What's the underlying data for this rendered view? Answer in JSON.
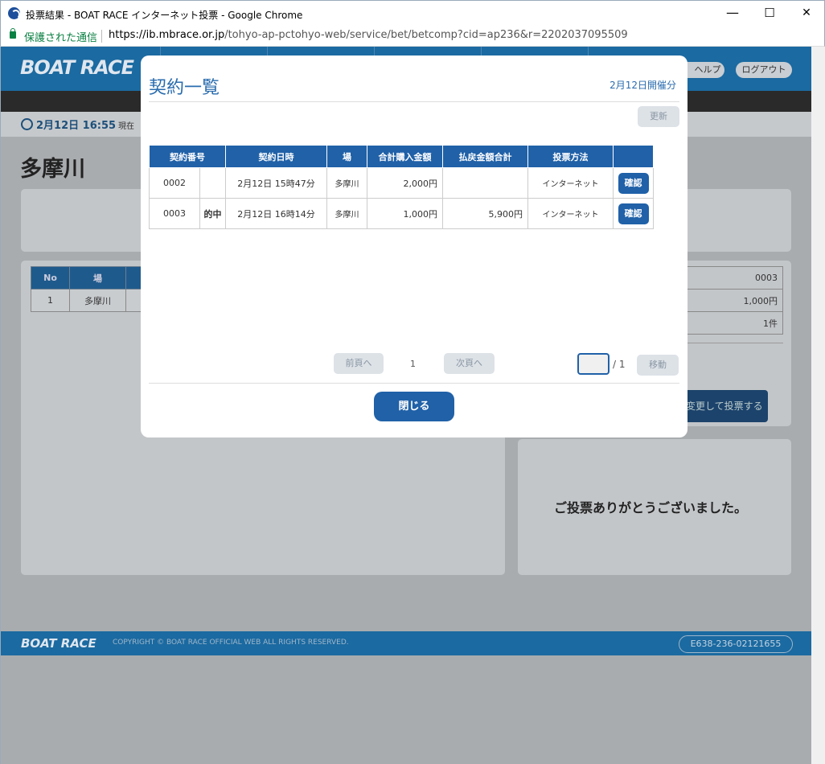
{
  "window": {
    "title": "投票結果 - BOAT RACE インターネット投票 - Google Chrome",
    "minimize": "—",
    "maximize": "☐",
    "close": "✕"
  },
  "address": {
    "secure_label": "保護された通信",
    "url_host": "https://ib.mbrace.or.jp",
    "url_path": "/tohyo-ap-pctohyo-web/service/bet/betcomp?cid=ap236&r=2202037095509"
  },
  "header": {
    "logo": "BOAT RACE",
    "help": "ヘルプ",
    "logout": "ログアウト"
  },
  "timebar": {
    "time": "2月12日 16:55",
    "now": "現在"
  },
  "place": "多摩川",
  "bg_table": {
    "headers": [
      "No",
      "場"
    ],
    "row": [
      "1",
      "多摩川"
    ]
  },
  "bg_summary": [
    "0003",
    "1,000円",
    "1件"
  ],
  "bg_bet_button": "変更して投票する",
  "thanks": "ご投票ありがとうございました。",
  "footer": {
    "logo": "BOAT RACE",
    "copyright": "COPYRIGHT © BOAT RACE OFFICIAL WEB ALL RIGHTS RESERVED.",
    "code": "E638-236-02121655"
  },
  "modal": {
    "title": "契約一覧",
    "date": "2月12日開催分",
    "refresh": "更新",
    "columns": [
      "契約番号",
      "契約日時",
      "場",
      "合計購入金額",
      "払戻金額合計",
      "投票方法"
    ],
    "rows": [
      {
        "no": "0002",
        "hit": "",
        "datetime": "2月12日 15時47分",
        "place": "多摩川",
        "amount": "2,000円",
        "payout": "",
        "method": "インターネット",
        "confirm": "確認"
      },
      {
        "no": "0003",
        "hit": "的中",
        "datetime": "2月12日 16時14分",
        "place": "多摩川",
        "amount": "1,000円",
        "payout": "5,900円",
        "method": "インターネット",
        "confirm": "確認"
      }
    ],
    "prev": "前頁へ",
    "page": "1",
    "next": "次頁へ",
    "total_pages": "/ 1",
    "move": "移動",
    "close": "閉じる"
  }
}
